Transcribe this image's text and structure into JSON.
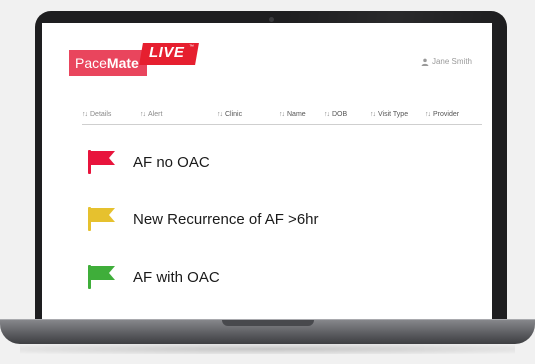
{
  "app": {
    "logo_pace": "Pace",
    "logo_mate": "Mate",
    "logo_live": "LIVE",
    "logo_tm": "™"
  },
  "user": {
    "name": "Jane Smith",
    "icon": "user-icon"
  },
  "table": {
    "sort_icon": "↑↓",
    "columns": [
      {
        "label": "Details"
      },
      {
        "label": "Alert"
      },
      {
        "label": "Clinic"
      },
      {
        "label": "Name"
      },
      {
        "label": "DOB"
      },
      {
        "label": "Visit Type"
      },
      {
        "label": "Provider"
      }
    ]
  },
  "flags": [
    {
      "label": "AF no OAC",
      "color": "#e8143c",
      "icon": "flag-icon"
    },
    {
      "label": "New Recurrence of AF >6hr",
      "color": "#e6c12e",
      "icon": "flag-icon"
    },
    {
      "label": "AF with OAC",
      "color": "#3fae3a",
      "icon": "flag-icon"
    }
  ],
  "colors": {
    "brand_pink": "#e9455d",
    "brand_red": "#e61f2f"
  }
}
